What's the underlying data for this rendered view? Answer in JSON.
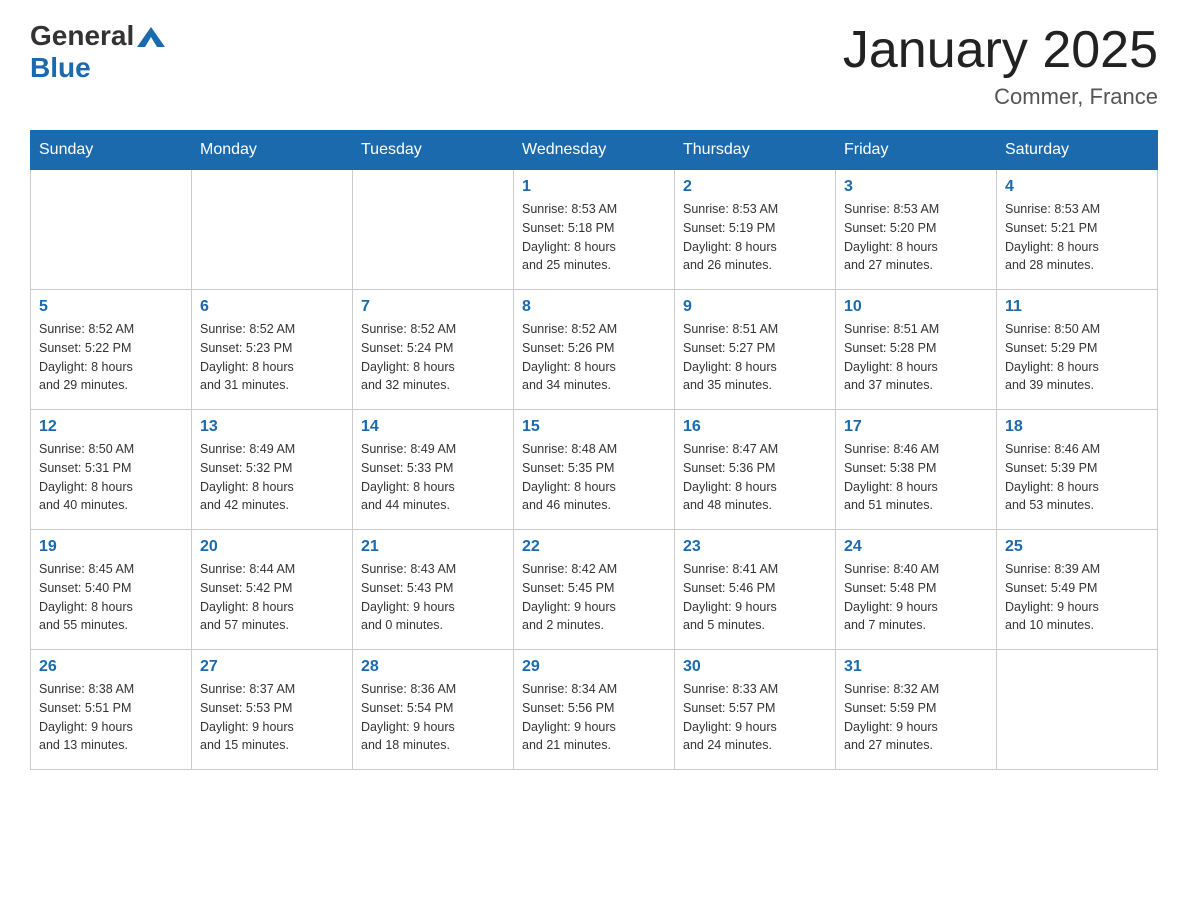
{
  "header": {
    "logo": {
      "general": "General",
      "blue": "Blue"
    },
    "title": "January 2025",
    "subtitle": "Commer, France"
  },
  "days_of_week": [
    "Sunday",
    "Monday",
    "Tuesday",
    "Wednesday",
    "Thursday",
    "Friday",
    "Saturday"
  ],
  "weeks": [
    [
      {
        "day": "",
        "info": ""
      },
      {
        "day": "",
        "info": ""
      },
      {
        "day": "",
        "info": ""
      },
      {
        "day": "1",
        "info": "Sunrise: 8:53 AM\nSunset: 5:18 PM\nDaylight: 8 hours\nand 25 minutes."
      },
      {
        "day": "2",
        "info": "Sunrise: 8:53 AM\nSunset: 5:19 PM\nDaylight: 8 hours\nand 26 minutes."
      },
      {
        "day": "3",
        "info": "Sunrise: 8:53 AM\nSunset: 5:20 PM\nDaylight: 8 hours\nand 27 minutes."
      },
      {
        "day": "4",
        "info": "Sunrise: 8:53 AM\nSunset: 5:21 PM\nDaylight: 8 hours\nand 28 minutes."
      }
    ],
    [
      {
        "day": "5",
        "info": "Sunrise: 8:52 AM\nSunset: 5:22 PM\nDaylight: 8 hours\nand 29 minutes."
      },
      {
        "day": "6",
        "info": "Sunrise: 8:52 AM\nSunset: 5:23 PM\nDaylight: 8 hours\nand 31 minutes."
      },
      {
        "day": "7",
        "info": "Sunrise: 8:52 AM\nSunset: 5:24 PM\nDaylight: 8 hours\nand 32 minutes."
      },
      {
        "day": "8",
        "info": "Sunrise: 8:52 AM\nSunset: 5:26 PM\nDaylight: 8 hours\nand 34 minutes."
      },
      {
        "day": "9",
        "info": "Sunrise: 8:51 AM\nSunset: 5:27 PM\nDaylight: 8 hours\nand 35 minutes."
      },
      {
        "day": "10",
        "info": "Sunrise: 8:51 AM\nSunset: 5:28 PM\nDaylight: 8 hours\nand 37 minutes."
      },
      {
        "day": "11",
        "info": "Sunrise: 8:50 AM\nSunset: 5:29 PM\nDaylight: 8 hours\nand 39 minutes."
      }
    ],
    [
      {
        "day": "12",
        "info": "Sunrise: 8:50 AM\nSunset: 5:31 PM\nDaylight: 8 hours\nand 40 minutes."
      },
      {
        "day": "13",
        "info": "Sunrise: 8:49 AM\nSunset: 5:32 PM\nDaylight: 8 hours\nand 42 minutes."
      },
      {
        "day": "14",
        "info": "Sunrise: 8:49 AM\nSunset: 5:33 PM\nDaylight: 8 hours\nand 44 minutes."
      },
      {
        "day": "15",
        "info": "Sunrise: 8:48 AM\nSunset: 5:35 PM\nDaylight: 8 hours\nand 46 minutes."
      },
      {
        "day": "16",
        "info": "Sunrise: 8:47 AM\nSunset: 5:36 PM\nDaylight: 8 hours\nand 48 minutes."
      },
      {
        "day": "17",
        "info": "Sunrise: 8:46 AM\nSunset: 5:38 PM\nDaylight: 8 hours\nand 51 minutes."
      },
      {
        "day": "18",
        "info": "Sunrise: 8:46 AM\nSunset: 5:39 PM\nDaylight: 8 hours\nand 53 minutes."
      }
    ],
    [
      {
        "day": "19",
        "info": "Sunrise: 8:45 AM\nSunset: 5:40 PM\nDaylight: 8 hours\nand 55 minutes."
      },
      {
        "day": "20",
        "info": "Sunrise: 8:44 AM\nSunset: 5:42 PM\nDaylight: 8 hours\nand 57 minutes."
      },
      {
        "day": "21",
        "info": "Sunrise: 8:43 AM\nSunset: 5:43 PM\nDaylight: 9 hours\nand 0 minutes."
      },
      {
        "day": "22",
        "info": "Sunrise: 8:42 AM\nSunset: 5:45 PM\nDaylight: 9 hours\nand 2 minutes."
      },
      {
        "day": "23",
        "info": "Sunrise: 8:41 AM\nSunset: 5:46 PM\nDaylight: 9 hours\nand 5 minutes."
      },
      {
        "day": "24",
        "info": "Sunrise: 8:40 AM\nSunset: 5:48 PM\nDaylight: 9 hours\nand 7 minutes."
      },
      {
        "day": "25",
        "info": "Sunrise: 8:39 AM\nSunset: 5:49 PM\nDaylight: 9 hours\nand 10 minutes."
      }
    ],
    [
      {
        "day": "26",
        "info": "Sunrise: 8:38 AM\nSunset: 5:51 PM\nDaylight: 9 hours\nand 13 minutes."
      },
      {
        "day": "27",
        "info": "Sunrise: 8:37 AM\nSunset: 5:53 PM\nDaylight: 9 hours\nand 15 minutes."
      },
      {
        "day": "28",
        "info": "Sunrise: 8:36 AM\nSunset: 5:54 PM\nDaylight: 9 hours\nand 18 minutes."
      },
      {
        "day": "29",
        "info": "Sunrise: 8:34 AM\nSunset: 5:56 PM\nDaylight: 9 hours\nand 21 minutes."
      },
      {
        "day": "30",
        "info": "Sunrise: 8:33 AM\nSunset: 5:57 PM\nDaylight: 9 hours\nand 24 minutes."
      },
      {
        "day": "31",
        "info": "Sunrise: 8:32 AM\nSunset: 5:59 PM\nDaylight: 9 hours\nand 27 minutes."
      },
      {
        "day": "",
        "info": ""
      }
    ]
  ]
}
